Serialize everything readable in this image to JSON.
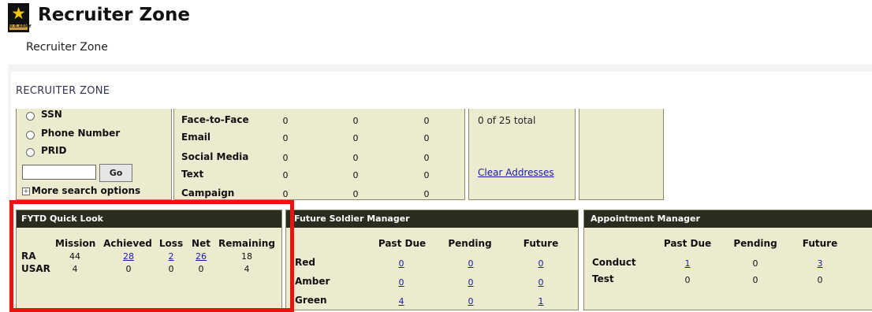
{
  "app": {
    "title": "Recruiter Zone",
    "breadcrumb": "Recruiter Zone",
    "section_title": "RECRUITER ZONE"
  },
  "search": {
    "options": [
      {
        "label": "SSN"
      },
      {
        "label": "Phone Number"
      },
      {
        "label": "PRID"
      }
    ],
    "input_value": "",
    "go_label": "Go",
    "more_label": "More search options"
  },
  "contacts": {
    "rows": [
      {
        "label": "Face-to-Face",
        "values": [
          "0",
          "0",
          "0"
        ]
      },
      {
        "label": "Email",
        "values": [
          "0",
          "0",
          "0"
        ]
      },
      {
        "label": "Social Media",
        "values": [
          "0",
          "0",
          "0"
        ]
      },
      {
        "label": "Text",
        "values": [
          "0",
          "0",
          "0"
        ]
      },
      {
        "label": "Campaign",
        "values": [
          "0",
          "0",
          "0"
        ]
      }
    ]
  },
  "addresses": {
    "total_text": "0 of 25 total",
    "clear_label": "Clear Addresses"
  },
  "fytd": {
    "title": "FYTD Quick Look",
    "headers": [
      "Mission",
      "Achieved",
      "Loss",
      "Net",
      "Remaining"
    ],
    "rows": [
      {
        "label": "RA",
        "mission": "44",
        "achieved": "28",
        "loss": "2",
        "net": "26",
        "remaining": "18"
      },
      {
        "label": "USAR",
        "mission": "4",
        "achieved": "0",
        "loss": "0",
        "net": "0",
        "remaining": "4"
      }
    ]
  },
  "future_soldier": {
    "title": "Future Soldier Manager",
    "headers": [
      "Past Due",
      "Pending",
      "Future"
    ],
    "rows": [
      {
        "label": "Red",
        "values": [
          "0",
          "0",
          "0"
        ]
      },
      {
        "label": "Amber",
        "values": [
          "0",
          "0",
          "0"
        ]
      },
      {
        "label": "Green",
        "values": [
          "4",
          "0",
          "1"
        ]
      }
    ]
  },
  "appointment": {
    "title": "Appointment Manager",
    "headers": [
      "Past Due",
      "Pending",
      "Future"
    ],
    "rows": [
      {
        "label": "Conduct",
        "values": [
          "1",
          "0",
          "3"
        ]
      },
      {
        "label": "Test",
        "values": [
          "0",
          "0",
          "0"
        ]
      }
    ]
  },
  "colors": {
    "box_bg": "#ecebcf",
    "header_bg": "#2b2b1f",
    "link": "#1a1aa6",
    "highlight": "#e8140f"
  },
  "icons": {
    "logo": "army-star-logo",
    "radio": "radio-icon",
    "expander": "plus-box-icon"
  }
}
